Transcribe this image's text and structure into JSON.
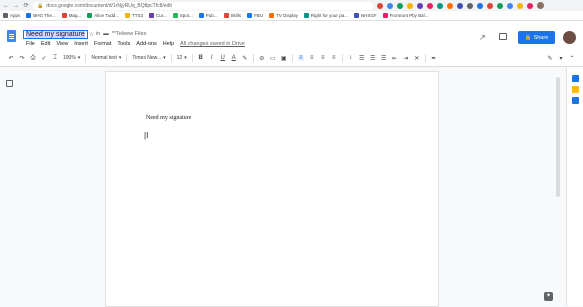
{
  "browser": {
    "url": "docs.google.com/document/d/1rNjyRUq_BQ8pcTfc8/edit",
    "back_glyph": "←",
    "forward_glyph": "→",
    "reload_glyph": "⟳"
  },
  "bookmarks": [
    {
      "label": "Apps",
      "color": "#5f6368"
    },
    {
      "label": "BHG The...",
      "color": "#1a73e8"
    },
    {
      "label": "Mag...",
      "color": "#db4437"
    },
    {
      "label": "Alice Tudd...",
      "color": "#0f9d58"
    },
    {
      "label": "TTS3",
      "color": "#f4b400"
    },
    {
      "label": "Cur...",
      "color": "#673ab7"
    },
    {
      "label": "Spot...",
      "color": "#1db954"
    },
    {
      "label": "Pub...",
      "color": "#1a73e8"
    },
    {
      "label": "Skills",
      "color": "#db4437"
    },
    {
      "label": "FBU",
      "color": "#1877f2"
    },
    {
      "label": "TV Display",
      "color": "#ff6d00"
    },
    {
      "label": "Right for your pa...",
      "color": "#009688"
    },
    {
      "label": "NHSGF",
      "color": "#3f51b5"
    },
    {
      "label": "Fromrunt Pby Bal...",
      "color": "#e91e63"
    }
  ],
  "header": {
    "doc_title": "Need my signature",
    "in_label": "in",
    "folder": "**Teleew Files",
    "menu": [
      "File",
      "Edit",
      "View",
      "Insert",
      "Format",
      "Tools",
      "Add-ons",
      "Help"
    ],
    "save_status": "All changes saved in Drive",
    "share_label": "Share",
    "share_icon": "lock-icon"
  },
  "toolbar": {
    "zoom": "100%",
    "style": "Normal text",
    "font": "Times New...",
    "size": "12",
    "bold": "B",
    "italic": "I",
    "underline": "U",
    "text_color": "A"
  },
  "document": {
    "body_line": "Need my signature",
    "cursor_glyph": "|I"
  },
  "side_apps": [
    {
      "name": "calendar",
      "color": "#1a73e8"
    },
    {
      "name": "keep",
      "color": "#fbbc04"
    },
    {
      "name": "tasks",
      "color": "#1a73e8"
    }
  ],
  "colors": {
    "accent": "#1a73e8",
    "docs_blue": "#4285f4"
  }
}
